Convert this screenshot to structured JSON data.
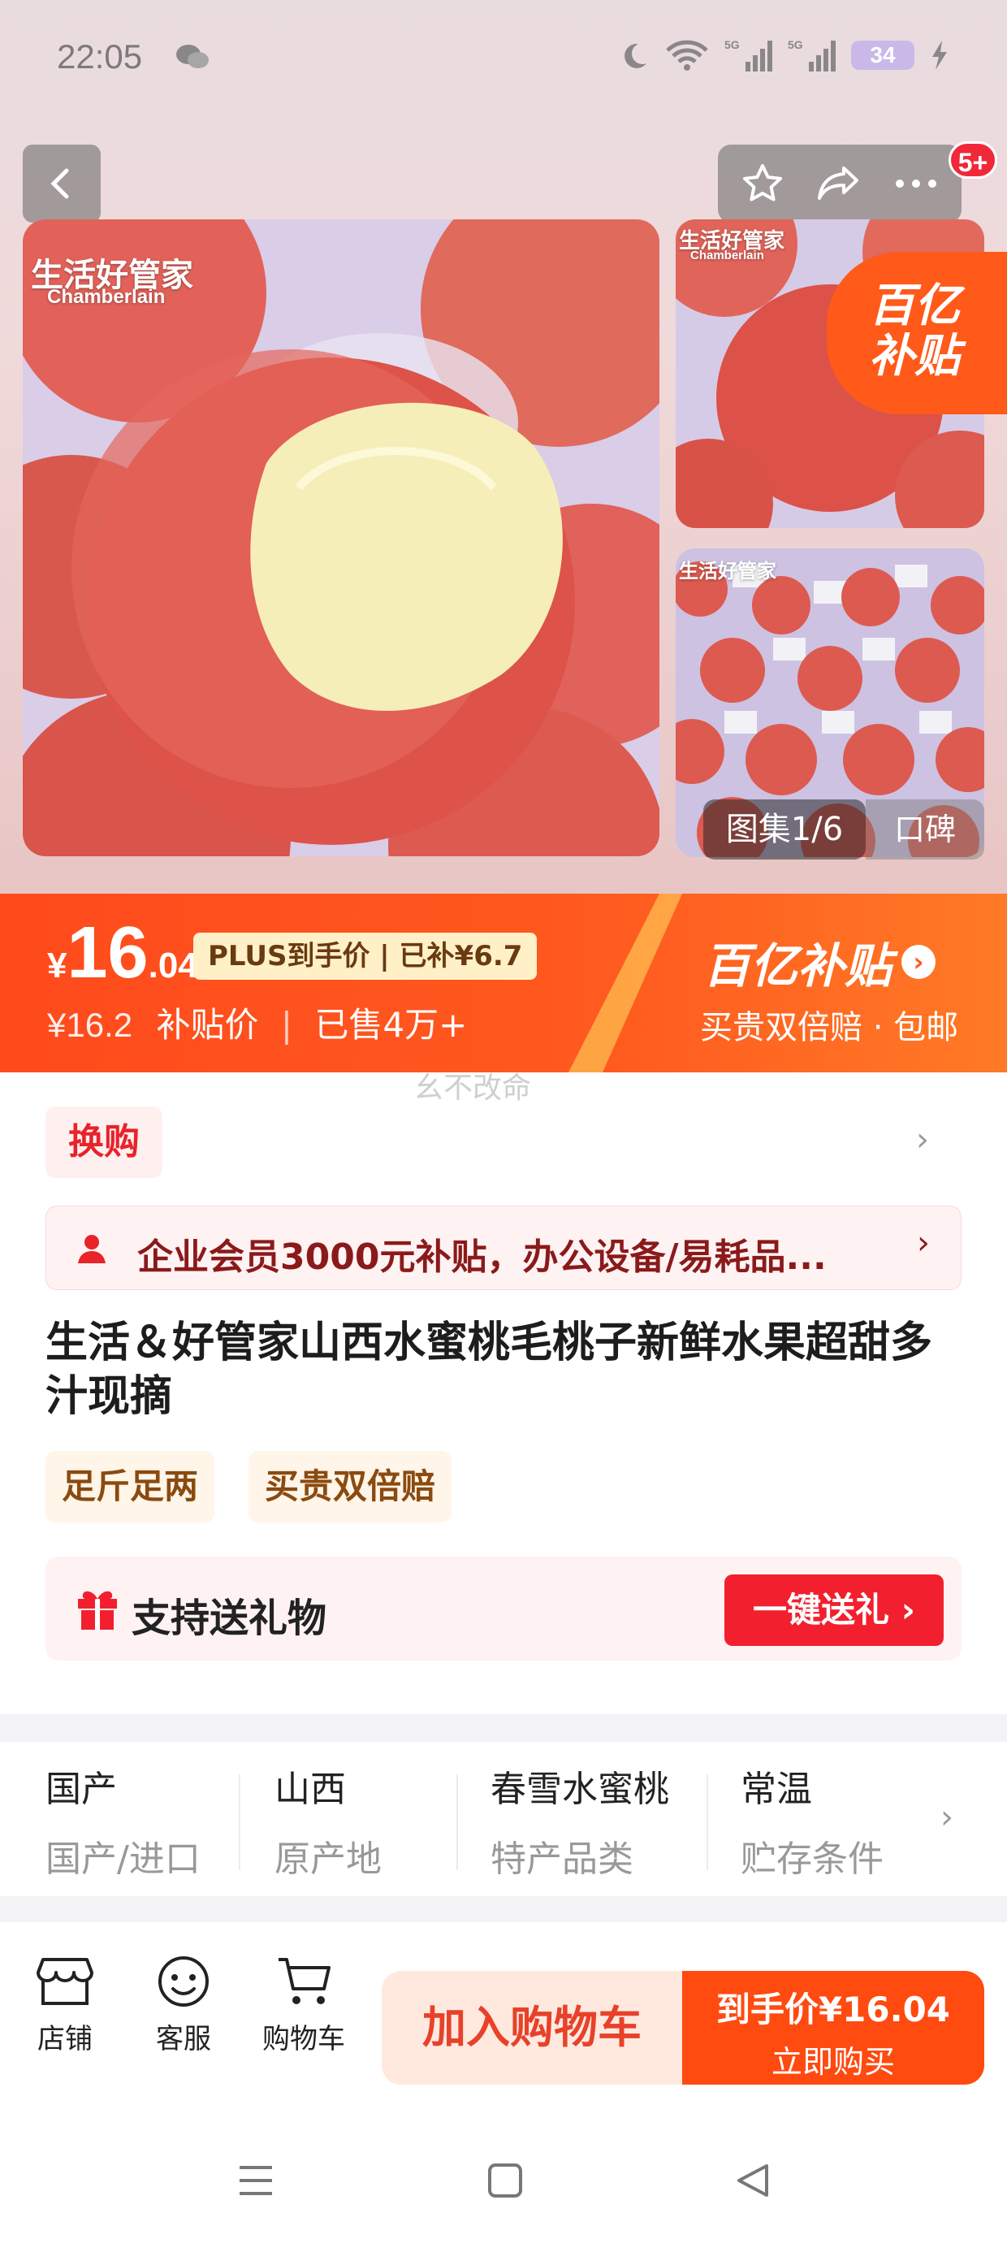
{
  "status_bar": {
    "time": "22:05",
    "battery": "34",
    "icons": [
      "wechat-icon",
      "moon-icon",
      "wifi-icon",
      "signal-5g-icon",
      "signal-5g-icon",
      "battery-icon",
      "charging-icon"
    ]
  },
  "top_actions": {
    "badge": "5+",
    "icons": [
      "back-icon",
      "star-icon",
      "share-icon",
      "more-icon"
    ]
  },
  "gallery": {
    "brand": "生活好管家",
    "brand_en": "Chamberlain",
    "subsidy_corner": "百亿\n补贴",
    "counter": "图集1/6",
    "extra": "口碑"
  },
  "price": {
    "symbol": "¥",
    "integer": "16",
    "decimal": ".04",
    "plus_tag": "PLUS到手价 | 已补¥6.7",
    "original": "¥16.2",
    "sub_label": "补贴价",
    "sold": "已售4万+",
    "band_title": "百亿补贴",
    "band_sub": "买贵双倍赔 · 包邮"
  },
  "watermark": "幺不改命",
  "exchange": {
    "label": "换购"
  },
  "biz_banner": {
    "text": "企业会员3000元补贴，办公设备/易耗品..."
  },
  "product": {
    "title": "生活＆好管家山西水蜜桃毛桃子新鲜水果超甜多汁现摘",
    "tags": [
      "足斤足两",
      "买贵双倍赔"
    ]
  },
  "gift": {
    "label": "支持送礼物",
    "button": "一键送礼 ›"
  },
  "attributes": [
    {
      "value": "国产",
      "key": "国产/进口"
    },
    {
      "value": "山西",
      "key": "原产地"
    },
    {
      "value": "春雪水蜜桃",
      "key": "特产品类"
    },
    {
      "value": "常温",
      "key": "贮存条件"
    }
  ],
  "bottom_bar": {
    "shop": "店铺",
    "service": "客服",
    "cart": "购物车",
    "add_to_cart": "加入购物车",
    "buy_price": "到手价¥16.04",
    "buy_now": "立即购买"
  },
  "colors": {
    "accent": "#ff4a1c",
    "buy": "#ff4a10",
    "gift_button": "#f2202e",
    "exchange": "#e8232a"
  }
}
